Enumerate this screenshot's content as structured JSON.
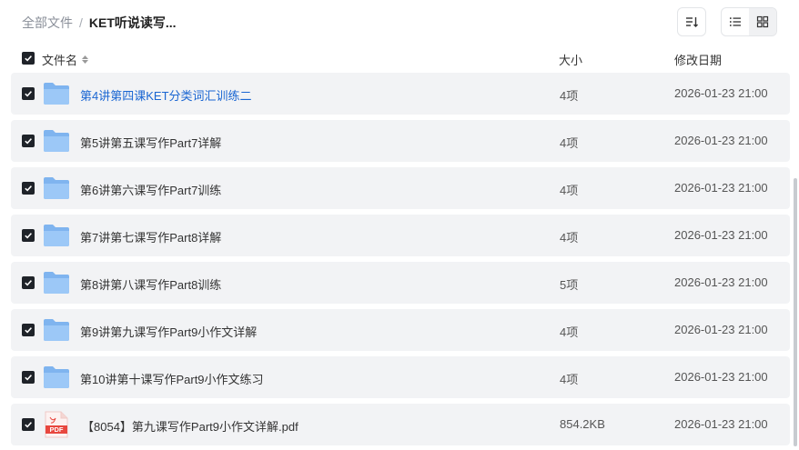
{
  "breadcrumb": {
    "root": "全部文件",
    "separator": "/",
    "current": "KET听说读写..."
  },
  "columns": {
    "name": "文件名",
    "size": "大小",
    "modified": "修改日期"
  },
  "rows": [
    {
      "name": "第4讲第四课KET分类词汇训练二",
      "size": "4项",
      "date": "2026-01-23 21:00",
      "type": "folder",
      "highlight": true
    },
    {
      "name": "第5讲第五课写作Part7详解",
      "size": "4项",
      "date": "2026-01-23 21:00",
      "type": "folder"
    },
    {
      "name": "第6讲第六课写作Part7训练",
      "size": "4项",
      "date": "2026-01-23 21:00",
      "type": "folder"
    },
    {
      "name": "第7讲第七课写作Part8详解",
      "size": "4项",
      "date": "2026-01-23 21:00",
      "type": "folder"
    },
    {
      "name": "第8讲第八课写作Part8训练",
      "size": "5项",
      "date": "2026-01-23 21:00",
      "type": "folder"
    },
    {
      "name": "第9讲第九课写作Part9小作文详解",
      "size": "4项",
      "date": "2026-01-23 21:00",
      "type": "folder"
    },
    {
      "name": "第10讲第十课写作Part9小作文练习",
      "size": "4项",
      "date": "2026-01-23 21:00",
      "type": "folder"
    },
    {
      "name": "【8054】第九课写作Part9小作文详解.pdf",
      "size": "854.2KB",
      "date": "2026-01-23 21:00",
      "type": "pdf",
      "icon_label": "PDF"
    }
  ],
  "colors": {
    "link": "#1a66d2",
    "row_bg": "#f2f3f5",
    "folder": "#7fb4ef",
    "pdf": "#e8473f"
  },
  "icons": {
    "sort": "sort-order-icon",
    "list_view": "list-view-icon",
    "grid_view": "grid-view-icon",
    "folder": "folder-icon",
    "pdf": "pdf-file-icon"
  }
}
